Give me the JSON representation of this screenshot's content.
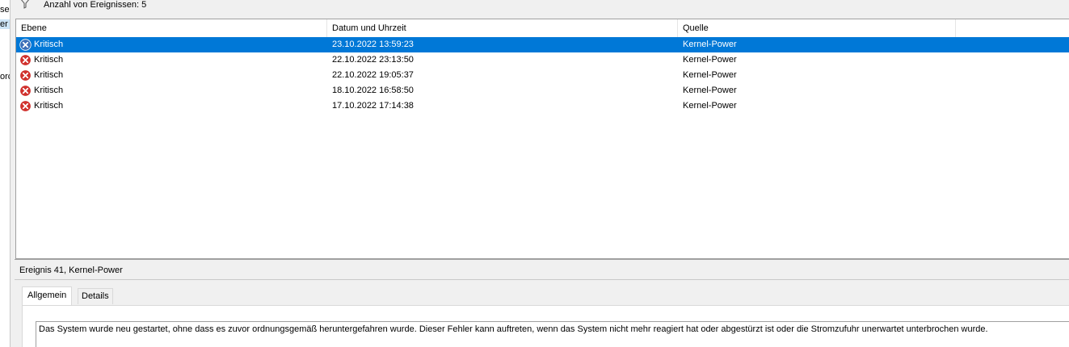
{
  "left_pane": {
    "fragments": [
      "se",
      "er",
      "orc"
    ]
  },
  "filter": {
    "icon": "filter-icon",
    "label": "Anzahl von Ereignissen: 5"
  },
  "list": {
    "columns": [
      "Ebene",
      "Datum und Uhrzeit",
      "Quelle"
    ],
    "rows": [
      {
        "level": "Kritisch",
        "datetime": "23.10.2022 13:59:23",
        "source": "Kernel-Power",
        "selected": true
      },
      {
        "level": "Kritisch",
        "datetime": "22.10.2022 23:13:50",
        "source": "Kernel-Power",
        "selected": false
      },
      {
        "level": "Kritisch",
        "datetime": "22.10.2022 19:05:37",
        "source": "Kernel-Power",
        "selected": false
      },
      {
        "level": "Kritisch",
        "datetime": "18.10.2022 16:58:50",
        "source": "Kernel-Power",
        "selected": false
      },
      {
        "level": "Kritisch",
        "datetime": "17.10.2022 17:14:38",
        "source": "Kernel-Power",
        "selected": false
      }
    ],
    "level_icon": "critical-error-icon"
  },
  "detail": {
    "title": "Ereignis 41, Kernel-Power",
    "tabs": [
      {
        "label": "Allgemein",
        "active": true
      },
      {
        "label": "Details",
        "active": false
      }
    ],
    "description": "Das System wurde neu gestartet, ohne dass es zuvor ordnungsgemäß heruntergefahren wurde. Dieser Fehler kann auftreten, wenn das System nicht mehr reagiert hat oder abgestürzt ist oder die Stromzufuhr unerwartet unterbrochen wurde."
  },
  "colors": {
    "selection": "#0078d7",
    "critical_red": "#d0312d",
    "selected_icon": "#3d6fb8"
  }
}
